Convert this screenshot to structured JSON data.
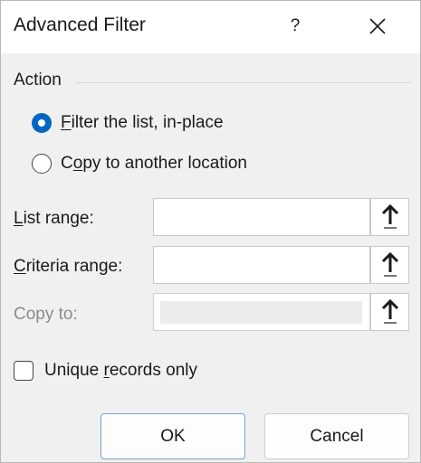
{
  "title": "Advanced Filter",
  "help_label": "?",
  "action": {
    "group_label": "Action",
    "options": [
      {
        "label_mnemonic": "F",
        "label_rest": "ilter the list, in-place",
        "checked": true
      },
      {
        "label_prefix": "C",
        "label_mnemonic": "o",
        "label_rest": "py to another location",
        "checked": false
      }
    ]
  },
  "fields": {
    "list_range": {
      "label_mnemonic": "L",
      "label_rest": "ist range:",
      "value": ""
    },
    "criteria_range": {
      "label_mnemonic": "C",
      "label_rest": "riteria range:",
      "value": ""
    },
    "copy_to": {
      "label": "Copy to:",
      "value": "",
      "disabled": true
    }
  },
  "unique": {
    "label_prefix": "Unique ",
    "label_mnemonic": "r",
    "label_rest": "ecords only",
    "checked": false
  },
  "buttons": {
    "ok": "OK",
    "cancel": "Cancel"
  },
  "colors": {
    "accent": "#0067c0",
    "disabled_text": "#8c8c8c"
  }
}
